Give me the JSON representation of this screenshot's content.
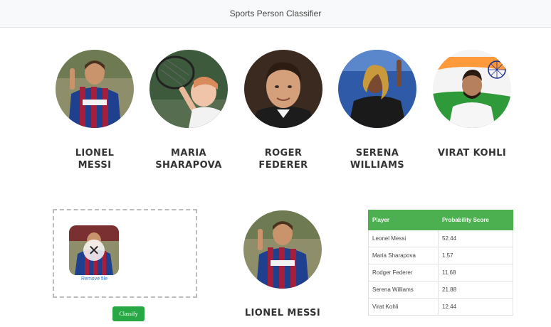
{
  "navbar": {
    "title": "Sports Person Classifier"
  },
  "players": [
    {
      "name": "LIONEL MESSI",
      "line1": "LIONEL",
      "line2": "MESSI"
    },
    {
      "name": "MARIA SHARAPOVA",
      "line1": "MARIA",
      "line2": "SHARAPOVA"
    },
    {
      "name": "ROGER FEDERER",
      "line1": "ROGER",
      "line2": "FEDERER"
    },
    {
      "name": "SERENA WILLIAMS",
      "line1": "SERENA",
      "line2": "WILLIAMS"
    },
    {
      "name": "VIRAT KOHLI",
      "line1": "VIRAT KOHLI",
      "line2": ""
    }
  ],
  "upload": {
    "remove_label": "Remove file",
    "remove_symbol": "✕",
    "classify_label": "Classify"
  },
  "result": {
    "name": "LIONEL MESSI"
  },
  "table": {
    "headers": [
      "Player",
      "Probability Score"
    ],
    "rows": [
      [
        "Leonel Messi",
        "52.44"
      ],
      [
        "Maria Sharapova",
        "1.57"
      ],
      [
        "Rodger Federer",
        "11.68"
      ],
      [
        "Serena Williams",
        "21.88"
      ],
      [
        "Virat Kohli",
        "12.44"
      ]
    ]
  },
  "colors": {
    "accent_green": "#28a745",
    "table_header_green": "#4caf50",
    "link_blue": "#2a7ad6",
    "navbar_bg": "#f8f9fa"
  }
}
